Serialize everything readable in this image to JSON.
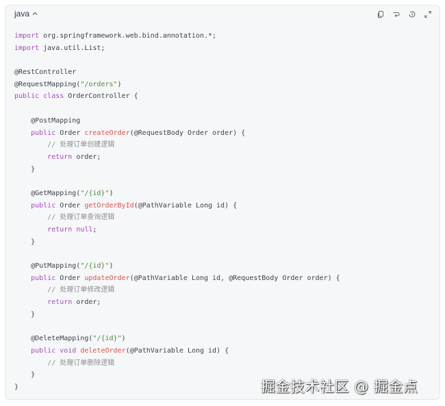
{
  "header": {
    "language": "java"
  },
  "toolbar": {
    "icons": [
      "copy-icon",
      "wrap-icon",
      "history-icon",
      "expand-icon"
    ]
  },
  "code_lines": [
    [
      {
        "t": "import",
        "c": "kw"
      },
      {
        "t": " org.springframework.web.bind.annotation.*;"
      }
    ],
    [
      {
        "t": "import",
        "c": "kw"
      },
      {
        "t": " java.util.List;"
      }
    ],
    [],
    [
      {
        "t": "@RestController"
      }
    ],
    [
      {
        "t": "@RequestMapping("
      },
      {
        "t": "\"/orders\"",
        "c": "str"
      },
      {
        "t": ")"
      }
    ],
    [
      {
        "t": "public",
        "c": "kw"
      },
      {
        "t": " "
      },
      {
        "t": "class",
        "c": "kw"
      },
      {
        "t": " OrderController {"
      }
    ],
    [],
    [
      {
        "t": "    @PostMapping"
      }
    ],
    [
      {
        "t": "    "
      },
      {
        "t": "public",
        "c": "kw"
      },
      {
        "t": " Order "
      },
      {
        "t": "createOrder",
        "c": "fn"
      },
      {
        "t": "(@RequestBody Order order) {"
      }
    ],
    [
      {
        "t": "        "
      },
      {
        "t": "// 处理订单创建逻辑",
        "c": "cm"
      }
    ],
    [
      {
        "t": "        "
      },
      {
        "t": "return",
        "c": "kw"
      },
      {
        "t": " order;"
      }
    ],
    [
      {
        "t": "    }"
      }
    ],
    [],
    [
      {
        "t": "    @GetMapping("
      },
      {
        "t": "\"/{id}\"",
        "c": "str"
      },
      {
        "t": ")"
      }
    ],
    [
      {
        "t": "    "
      },
      {
        "t": "public",
        "c": "kw"
      },
      {
        "t": " Order "
      },
      {
        "t": "getOrderById",
        "c": "fn"
      },
      {
        "t": "(@PathVariable Long id) {"
      }
    ],
    [
      {
        "t": "        "
      },
      {
        "t": "// 处理订单查询逻辑",
        "c": "cm"
      }
    ],
    [
      {
        "t": "        "
      },
      {
        "t": "return",
        "c": "kw"
      },
      {
        "t": " "
      },
      {
        "t": "null",
        "c": "kw"
      },
      {
        "t": ";"
      }
    ],
    [
      {
        "t": "    }"
      }
    ],
    [],
    [
      {
        "t": "    @PutMapping("
      },
      {
        "t": "\"/{id}\"",
        "c": "str"
      },
      {
        "t": ")"
      }
    ],
    [
      {
        "t": "    "
      },
      {
        "t": "public",
        "c": "kw"
      },
      {
        "t": " Order "
      },
      {
        "t": "updateOrder",
        "c": "fn"
      },
      {
        "t": "(@PathVariable Long id, @RequestBody Order order) {"
      }
    ],
    [
      {
        "t": "        "
      },
      {
        "t": "// 处理订单修改逻辑",
        "c": "cm"
      }
    ],
    [
      {
        "t": "        "
      },
      {
        "t": "return",
        "c": "kw"
      },
      {
        "t": " order;"
      }
    ],
    [
      {
        "t": "    }"
      }
    ],
    [],
    [
      {
        "t": "    @DeleteMapping("
      },
      {
        "t": "\"/{id}\"",
        "c": "str"
      },
      {
        "t": ")"
      }
    ],
    [
      {
        "t": "    "
      },
      {
        "t": "public",
        "c": "kw"
      },
      {
        "t": " "
      },
      {
        "t": "void",
        "c": "kw"
      },
      {
        "t": " "
      },
      {
        "t": "deleteOrder",
        "c": "fn"
      },
      {
        "t": "(@PathVariable Long id) {"
      }
    ],
    [
      {
        "t": "        "
      },
      {
        "t": "// 处理订单删除逻辑",
        "c": "cm"
      }
    ],
    [
      {
        "t": "    }"
      }
    ],
    [
      {
        "t": "}"
      }
    ]
  ],
  "watermark": "掘金技术社区 @ 掘金点",
  "colors": {
    "keyword": "#a14bbd",
    "string": "#4f8a3a",
    "function": "#d7544a",
    "comment": "#8c8c8c",
    "text": "#3b3f45",
    "background": "#f6f7f9"
  }
}
